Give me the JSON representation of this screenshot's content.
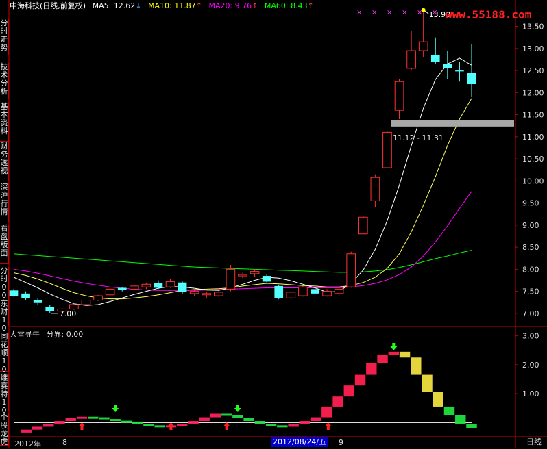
{
  "sidebar": {
    "tabs": [
      {
        "label": "分时走势"
      },
      {
        "label": "技术分析"
      },
      {
        "label": "基本资料"
      },
      {
        "label": "财务透视"
      },
      {
        "label": "深沪行情"
      },
      {
        "label": "看盘版面"
      },
      {
        "label": "分时00东财10"
      },
      {
        "label": "同花顺10"
      },
      {
        "label": "维赛特10"
      },
      {
        "label": "个股龙虎"
      }
    ]
  },
  "header": {
    "stock": "中海科技(日线,前复权)",
    "ma5": "MA5: 12.62",
    "ma5_arrow": "↓",
    "ma10": "MA10: 11.87",
    "ma10_arrow": "↑",
    "ma20": "MA20: 9.76",
    "ma20_arrow": "↑",
    "ma60": "MA60: 8.43",
    "ma60_arrow": "↑",
    "colors": {
      "stock": "#ffffff",
      "ma5": "#ffffff",
      "ma10": "#ffff00",
      "ma20": "#ff00ff",
      "ma60": "#00ff00",
      "arrow": "#ff4040"
    }
  },
  "watermark": "www.55188.com",
  "price_axis": {
    "labels": [
      "13.50",
      "13.00",
      "12.50",
      "12.00",
      "11.50",
      "11.00",
      "10.50",
      "10.00",
      "9.50",
      "9.00",
      "8.50",
      "8.00",
      "7.50",
      "7.00"
    ],
    "min": 6.75,
    "max": 13.85
  },
  "indicator": {
    "title": "大雪寻牛",
    "divider": "分界: 0.00",
    "axis_labels": [
      "3.00",
      "2.00",
      "1.00"
    ],
    "min": -0.4,
    "max": 3.3
  },
  "annotations": {
    "high": "13.90",
    "low": "7.00",
    "range": "11.12 - 11.31"
  },
  "bottom_bar": {
    "year": "2012年",
    "month_a": "8",
    "cursor_date": "2012/08/24/五",
    "month_b": "9",
    "timeframe": "日线"
  },
  "chart_data": {
    "type": "candlestick",
    "candles": [
      {
        "o": 7.52,
        "h": 7.55,
        "l": 7.38,
        "c": 7.4
      },
      {
        "o": 7.45,
        "h": 7.5,
        "l": 7.3,
        "c": 7.35
      },
      {
        "o": 7.3,
        "h": 7.35,
        "l": 7.2,
        "c": 7.25
      },
      {
        "o": 7.15,
        "h": 7.2,
        "l": 7.0,
        "c": 7.05
      },
      {
        "o": 7.05,
        "h": 7.12,
        "l": 7.0,
        "c": 7.1
      },
      {
        "o": 7.1,
        "h": 7.22,
        "l": 7.08,
        "c": 7.2
      },
      {
        "o": 7.2,
        "h": 7.32,
        "l": 7.18,
        "c": 7.3
      },
      {
        "o": 7.3,
        "h": 7.42,
        "l": 7.28,
        "c": 7.4
      },
      {
        "o": 7.42,
        "h": 7.58,
        "l": 7.4,
        "c": 7.55
      },
      {
        "o": 7.58,
        "h": 7.6,
        "l": 7.5,
        "c": 7.53
      },
      {
        "o": 7.55,
        "h": 7.65,
        "l": 7.52,
        "c": 7.62
      },
      {
        "o": 7.6,
        "h": 7.7,
        "l": 7.55,
        "c": 7.66
      },
      {
        "o": 7.68,
        "h": 7.75,
        "l": 7.55,
        "c": 7.58
      },
      {
        "o": 7.6,
        "h": 7.78,
        "l": 7.58,
        "c": 7.72
      },
      {
        "o": 7.7,
        "h": 7.72,
        "l": 7.45,
        "c": 7.48
      },
      {
        "o": 7.45,
        "h": 7.52,
        "l": 7.4,
        "c": 7.5
      },
      {
        "o": 7.42,
        "h": 7.48,
        "l": 7.35,
        "c": 7.45
      },
      {
        "o": 7.4,
        "h": 7.5,
        "l": 7.38,
        "c": 7.48
      },
      {
        "o": 7.55,
        "h": 8.1,
        "l": 7.5,
        "c": 8.0
      },
      {
        "o": 7.85,
        "h": 7.92,
        "l": 7.8,
        "c": 7.88
      },
      {
        "o": 7.9,
        "h": 8.0,
        "l": 7.82,
        "c": 7.95
      },
      {
        "o": 7.85,
        "h": 7.88,
        "l": 7.7,
        "c": 7.72
      },
      {
        "o": 7.62,
        "h": 7.65,
        "l": 7.32,
        "c": 7.35
      },
      {
        "o": 7.35,
        "h": 7.5,
        "l": 7.32,
        "c": 7.48
      },
      {
        "o": 7.4,
        "h": 7.62,
        "l": 7.38,
        "c": 7.6
      },
      {
        "o": 7.55,
        "h": 7.6,
        "l": 7.15,
        "c": 7.45
      },
      {
        "o": 7.4,
        "h": 7.55,
        "l": 7.38,
        "c": 7.5
      },
      {
        "o": 7.45,
        "h": 7.6,
        "l": 7.4,
        "c": 7.55
      },
      {
        "o": 7.6,
        "h": 8.4,
        "l": 7.58,
        "c": 8.35
      },
      {
        "o": 8.8,
        "h": 9.2,
        "l": 8.8,
        "c": 9.18
      },
      {
        "o": 9.55,
        "h": 10.15,
        "l": 9.4,
        "c": 10.08
      },
      {
        "o": 10.3,
        "h": 11.12,
        "l": 10.3,
        "c": 11.1
      },
      {
        "o": 11.6,
        "h": 12.3,
        "l": 11.4,
        "c": 12.25
      },
      {
        "o": 12.55,
        "h": 13.4,
        "l": 12.5,
        "c": 12.95
      },
      {
        "o": 12.95,
        "h": 13.9,
        "l": 12.8,
        "c": 13.15
      },
      {
        "o": 12.85,
        "h": 13.25,
        "l": 12.65,
        "c": 12.7
      },
      {
        "o": 12.65,
        "h": 12.95,
        "l": 12.3,
        "c": 12.55
      },
      {
        "o": 12.5,
        "h": 12.7,
        "l": 12.25,
        "c": 12.48
      },
      {
        "o": 12.45,
        "h": 13.1,
        "l": 11.9,
        "c": 12.2
      }
    ],
    "ma5": [
      7.82,
      7.7,
      7.58,
      7.44,
      7.32,
      7.22,
      7.18,
      7.2,
      7.27,
      7.35,
      7.43,
      7.5,
      7.57,
      7.61,
      7.6,
      7.57,
      7.53,
      7.52,
      7.58,
      7.66,
      7.75,
      7.82,
      7.8,
      7.74,
      7.66,
      7.58,
      7.48,
      7.5,
      7.68,
      7.98,
      8.45,
      9.1,
      9.9,
      10.8,
      11.65,
      12.3,
      12.65,
      12.78,
      12.62
    ],
    "ma10": [
      7.92,
      7.86,
      7.78,
      7.68,
      7.57,
      7.47,
      7.4,
      7.35,
      7.33,
      7.33,
      7.35,
      7.38,
      7.42,
      7.47,
      7.52,
      7.54,
      7.55,
      7.56,
      7.58,
      7.62,
      7.65,
      7.68,
      7.67,
      7.65,
      7.63,
      7.62,
      7.6,
      7.6,
      7.63,
      7.7,
      7.82,
      8.02,
      8.35,
      8.85,
      9.45,
      10.1,
      10.8,
      11.4,
      11.87
    ],
    "ma20": [
      8.0,
      7.96,
      7.91,
      7.85,
      7.79,
      7.73,
      7.68,
      7.64,
      7.6,
      7.57,
      7.55,
      7.53,
      7.52,
      7.52,
      7.52,
      7.52,
      7.53,
      7.54,
      7.55,
      7.56,
      7.57,
      7.58,
      7.58,
      7.58,
      7.58,
      7.58,
      7.58,
      7.58,
      7.6,
      7.63,
      7.68,
      7.76,
      7.88,
      8.05,
      8.3,
      8.62,
      8.98,
      9.38,
      9.76
    ],
    "ma60": [
      8.35,
      8.33,
      8.31,
      8.29,
      8.27,
      8.25,
      8.23,
      8.21,
      8.19,
      8.17,
      8.15,
      8.13,
      8.11,
      8.09,
      8.07,
      8.05,
      8.04,
      8.03,
      8.02,
      8.01,
      8.0,
      7.99,
      7.98,
      7.97,
      7.96,
      7.95,
      7.94,
      7.93,
      7.93,
      7.94,
      7.96,
      7.99,
      8.04,
      8.1,
      8.17,
      8.24,
      8.3,
      8.37,
      8.43
    ],
    "indicator_values": [
      -0.35,
      -0.25,
      -0.15,
      -0.05,
      0.05,
      0.15,
      0.2,
      0.18,
      0.12,
      0.06,
      0.03,
      -0.05,
      -0.1,
      -0.15,
      -0.1,
      -0.05,
      0.05,
      0.18,
      0.3,
      0.25,
      0.15,
      0.05,
      -0.05,
      -0.1,
      -0.15,
      -0.05,
      0.05,
      0.18,
      0.55,
      0.9,
      1.28,
      1.65,
      2.05,
      2.35,
      2.45,
      2.25,
      1.65,
      1.05,
      0.55,
      0.25,
      -0.05,
      -0.2
    ],
    "up_arrows_idx": [
      6,
      14,
      19,
      28
    ],
    "down_arrows_idx": [
      9,
      20,
      34
    ]
  }
}
